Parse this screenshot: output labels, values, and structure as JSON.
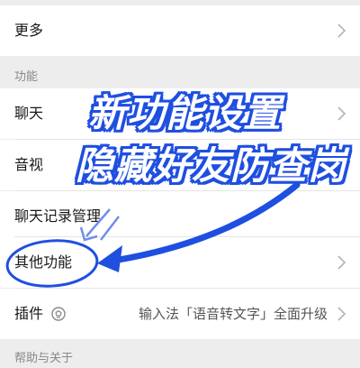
{
  "settings": {
    "more_label": "更多",
    "section_features": "功能",
    "chat_label": "聊天",
    "audio_video_label": "音视",
    "chat_history_label": "聊天记录管理",
    "other_features_label": "其他功能",
    "plugins_label": "插件",
    "plugins_desc": "输入法「语音转文字」全面升级",
    "section_help": "帮助与关于"
  },
  "overlay": {
    "line1": "新功能设置",
    "line2": "隐藏好友防查岗"
  },
  "colors": {
    "annotation_blue": "#1f4fe0",
    "chevron": "#b2b2b2"
  }
}
